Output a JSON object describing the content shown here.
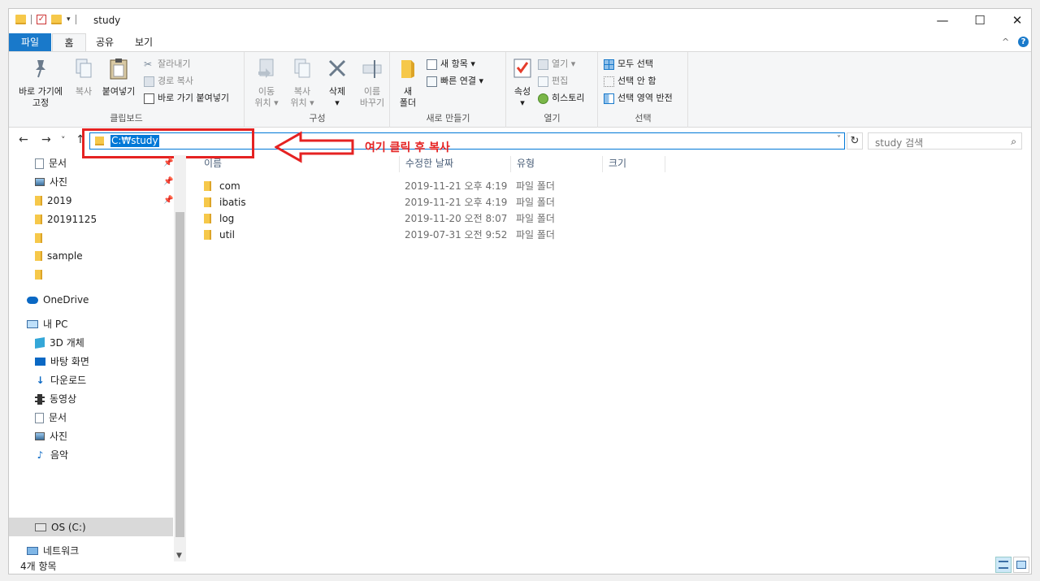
{
  "window": {
    "title": "study",
    "min_glyph": "—",
    "max_glyph": "☐",
    "close_glyph": "✕"
  },
  "tabs": {
    "file": "파일",
    "home": "홈",
    "share": "공유",
    "view": "보기",
    "collapse_glyph": "^",
    "help_glyph": "?"
  },
  "ribbon": {
    "clipboard": {
      "label": "클립보드",
      "pin_quick": "바로 가기에\n고정",
      "copy": "복사",
      "paste": "붙여넣기",
      "cut": "잘라내기",
      "copy_path": "경로 복사",
      "paste_shortcut": "바로 가기 붙여넣기"
    },
    "organize": {
      "label": "구성",
      "move_to": "이동\n위치 ▾",
      "copy_to": "복사\n위치 ▾",
      "delete": "삭제\n▾",
      "rename": "이름\n바꾸기"
    },
    "new": {
      "label": "새로 만들기",
      "new_folder": "새\n폴더",
      "new_item": "새 항목 ▾",
      "easy_access": "빠른 연결 ▾"
    },
    "open": {
      "label": "열기",
      "properties": "속성\n▾",
      "open": "열기 ▾",
      "edit": "편집",
      "history": "히스토리"
    },
    "select": {
      "label": "선택",
      "select_all": "모두 선택",
      "select_none": "선택 안 함",
      "invert": "선택 영역 반전"
    }
  },
  "address": {
    "path": "C:₩study",
    "search_placeholder": "study 검색",
    "back_glyph": "←",
    "forward_glyph": "→",
    "recent_glyph": "˅",
    "up_glyph": "↑",
    "dropdown_glyph": "˅",
    "refresh_glyph": "↻",
    "search_glyph": "⌕"
  },
  "annotation": {
    "text": "여기 클릭 후 복사",
    "color": "#e52222"
  },
  "nav": {
    "pinned": [
      {
        "label": "문서",
        "pinned": true
      },
      {
        "label": "사진",
        "pinned": true
      },
      {
        "label": "2019",
        "pinned": true
      },
      {
        "label": "20191125",
        "pinned": false
      },
      {
        "label": "",
        "pinned": false
      },
      {
        "label": "sample",
        "pinned": false
      },
      {
        "label": "",
        "pinned": false
      }
    ],
    "onedrive": "OneDrive",
    "thispc": "내 PC",
    "pc_items": [
      "3D 개체",
      "바탕 화면",
      "다운로드",
      "동영상",
      "문서",
      "사진",
      "음악"
    ],
    "drive": "OS (C:)",
    "network": "네트워크"
  },
  "columns": {
    "name": "이름",
    "date": "수정한 날짜",
    "type": "유형",
    "size": "크기"
  },
  "files": [
    {
      "name": "com",
      "date": "2019-11-21 오후 4:19",
      "type": "파일 폴더"
    },
    {
      "name": "ibatis",
      "date": "2019-11-21 오후 4:19",
      "type": "파일 폴더"
    },
    {
      "name": "log",
      "date": "2019-11-20 오전 8:07",
      "type": "파일 폴더"
    },
    {
      "name": "util",
      "date": "2019-07-31 오전 9:52",
      "type": "파일 폴더"
    }
  ],
  "status": {
    "count": "4개 항목"
  }
}
